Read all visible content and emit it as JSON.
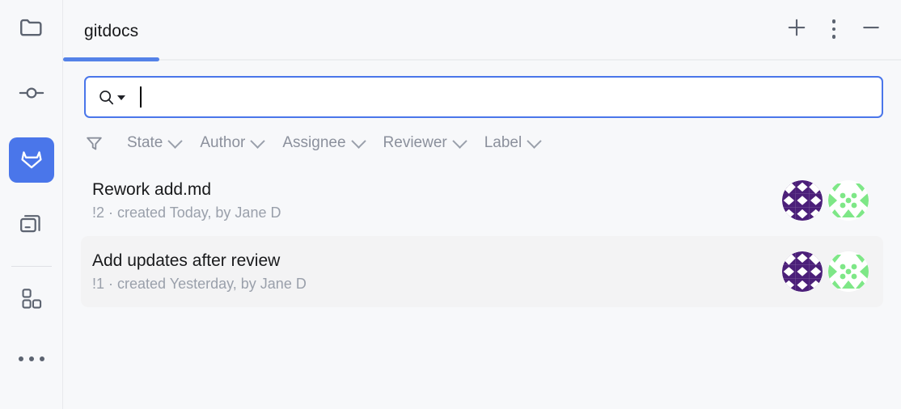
{
  "window": {
    "title": "gitdocs"
  },
  "sidebar": {
    "items": [
      {
        "name": "project-folder",
        "icon": "folder-icon",
        "active": false
      },
      {
        "name": "commits",
        "icon": "commit-node-icon",
        "active": false
      },
      {
        "name": "gitlab",
        "icon": "gitlab-fox-icon",
        "active": true
      },
      {
        "name": "windows",
        "icon": "copy-windows-icon",
        "active": false
      },
      {
        "name": "plugins",
        "icon": "blocks-icon",
        "active": false
      },
      {
        "name": "more",
        "icon": "more-horizontal-icon",
        "active": false
      }
    ]
  },
  "header": {
    "tabs": [
      {
        "label": "gitdocs",
        "active": true
      }
    ],
    "actions": [
      {
        "name": "add-button",
        "icon": "plus-icon",
        "label": "+"
      },
      {
        "name": "more-options-button",
        "icon": "kebab-vertical-icon",
        "label": ""
      },
      {
        "name": "minimize-button",
        "icon": "minus-icon",
        "label": "—"
      }
    ]
  },
  "search": {
    "value": "",
    "placeholder": "",
    "icon": "search-dropdown-icon"
  },
  "filters": {
    "icon": "filter-funnel-icon",
    "items": [
      {
        "label": "State"
      },
      {
        "label": "Author"
      },
      {
        "label": "Assignee"
      },
      {
        "label": "Reviewer"
      },
      {
        "label": "Label"
      }
    ]
  },
  "merge_requests": [
    {
      "title": "Rework add.md",
      "meta": "!2 · created Today, by Jane D",
      "selected": false,
      "avatars": [
        "identicon-purple",
        "identicon-green"
      ]
    },
    {
      "title": "Add updates after review",
      "meta": "!1 · created Yesterday, by Jane D",
      "selected": true,
      "avatars": [
        "identicon-purple",
        "identicon-green"
      ]
    }
  ],
  "colors": {
    "accent": "#4a76ea",
    "tab_indicator": "#5482e8",
    "background": "#f7f8fa",
    "selected_row": "#f3f3f4",
    "icon_gray": "#5c6370",
    "muted_text": "#9aa0ab",
    "avatar_purple": "#4b1f79",
    "avatar_green": "#7ee787"
  }
}
